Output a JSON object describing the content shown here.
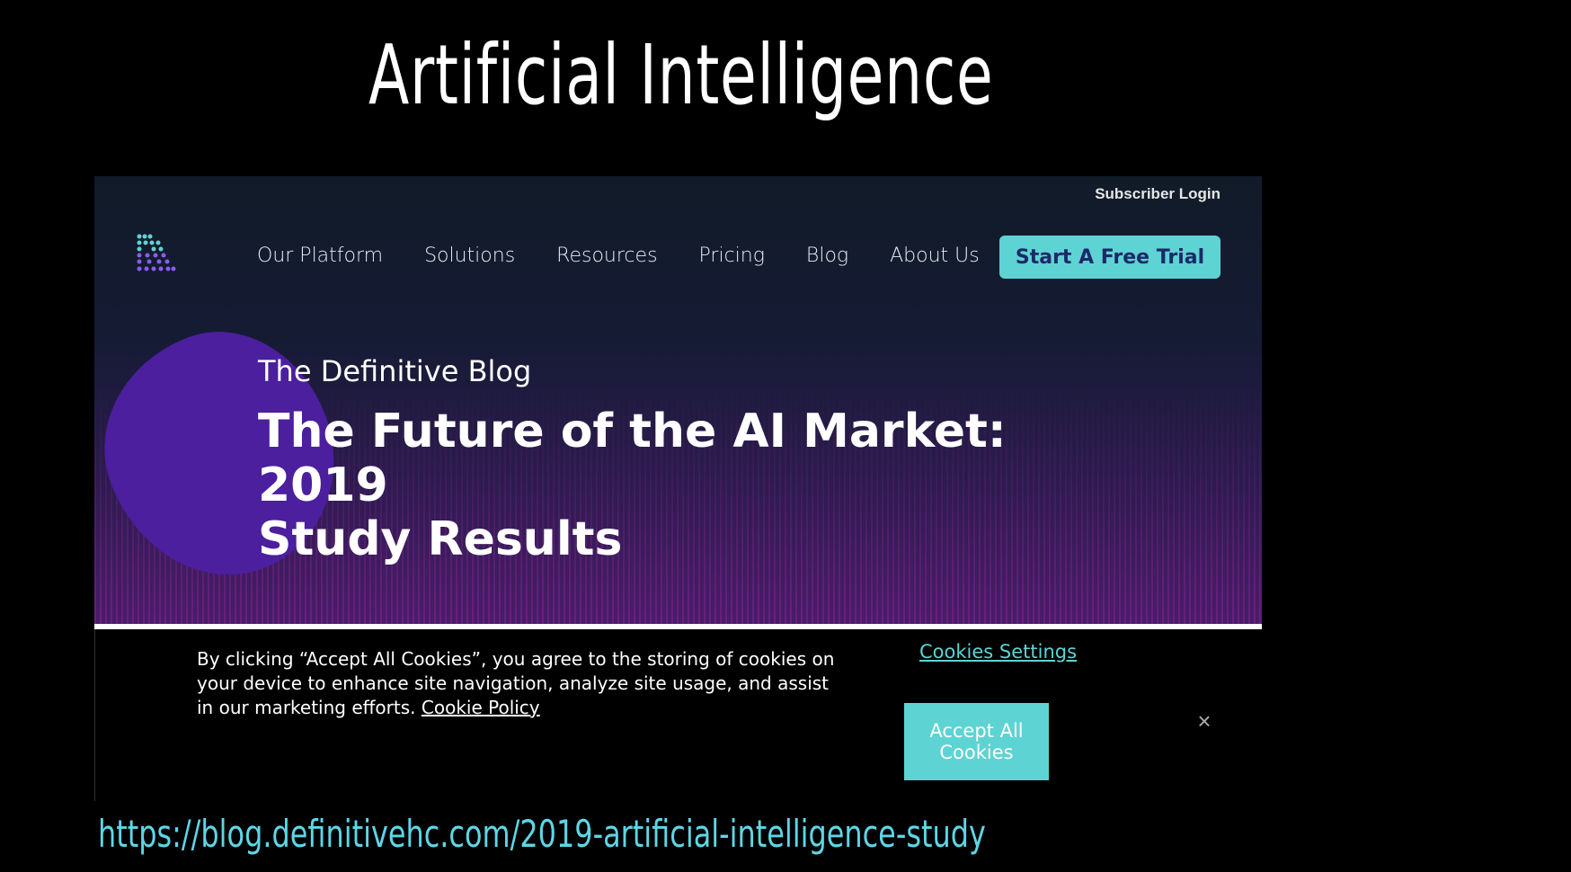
{
  "slide": {
    "title": "Artificial Intelligence",
    "url": "https://blog.definitivehc.com/2019-artificial-intelligence-study"
  },
  "site": {
    "subscriber_login": "Subscriber Login",
    "logo_icon": "dots-logo-icon",
    "nav": [
      {
        "label": "Our Platform"
      },
      {
        "label": "Solutions"
      },
      {
        "label": "Resources"
      },
      {
        "label": "Pricing"
      },
      {
        "label": "Blog"
      },
      {
        "label": "About Us"
      }
    ],
    "cta": "Start A Free Trial",
    "eyebrow": "The Definitive Blog",
    "headline_line1": "The Future of the AI Market: 2019",
    "headline_line2": "Study Results"
  },
  "cookie_banner": {
    "text": "By clicking “Accept All Cookies”, you agree to the storing of cookies on your device to enhance site navigation, analyze site usage, and assist in our marketing efforts.",
    "policy_link": "Cookie Policy",
    "settings_link": "Cookies Settings",
    "accept_label_line1": "Accept All",
    "accept_label_line2": "Cookies",
    "close_glyph": "×"
  },
  "colors": {
    "accent": "#5ed3d3",
    "cta_text": "#1a2a68",
    "blob": "#4b1f9e",
    "url": "#5ed6e6"
  }
}
